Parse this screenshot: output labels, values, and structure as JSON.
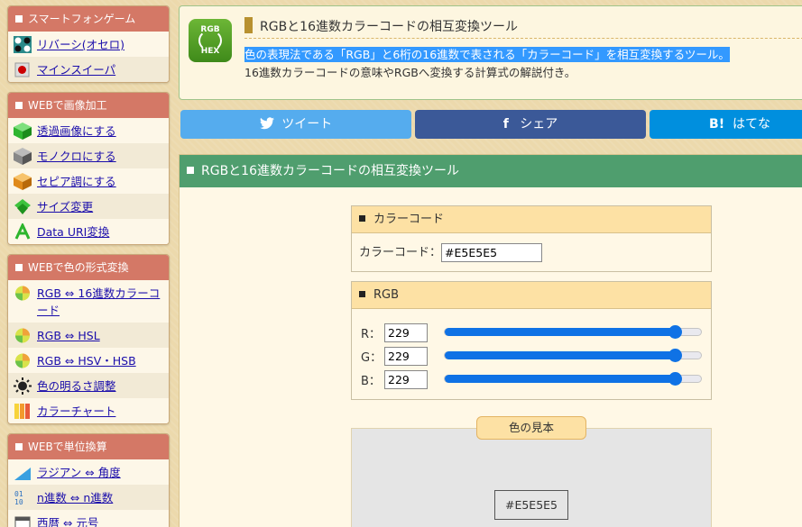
{
  "sidebar": {
    "sections": [
      {
        "title": "スマートフォンゲーム",
        "items": [
          {
            "label": "リバーシ(オセロ)",
            "icon": "reversi-icon"
          },
          {
            "label": "マインスイーパ",
            "icon": "mine-icon"
          }
        ]
      },
      {
        "title": "WEBで画像加工",
        "items": [
          {
            "label": "透過画像にする",
            "icon": "green-cube-icon"
          },
          {
            "label": "モノクロにする",
            "icon": "gray-cube-icon"
          },
          {
            "label": "セピア調にする",
            "icon": "orange-cube-icon"
          },
          {
            "label": "サイズ変更",
            "icon": "resize-icon"
          },
          {
            "label": "Data URI変換",
            "icon": "data-uri-icon"
          }
        ]
      },
      {
        "title": "WEBで色の形式変換",
        "items": [
          {
            "label": "RGB ⇔ 16進数カラーコード",
            "icon": "color-ball-icon"
          },
          {
            "label": "RGB ⇔ HSL",
            "icon": "color-ball-icon"
          },
          {
            "label": "RGB ⇔ HSV・HSB",
            "icon": "color-ball-icon"
          },
          {
            "label": "色の明るさ調整",
            "icon": "brightness-icon"
          },
          {
            "label": "カラーチャート",
            "icon": "color-chart-icon"
          }
        ]
      },
      {
        "title": "WEBで単位換算",
        "items": [
          {
            "label": "ラジアン ⇔ 角度",
            "icon": "angle-icon"
          },
          {
            "label": "n進数 ⇔ n進数",
            "icon": "binary-icon"
          },
          {
            "label": "西暦 ⇔ 元号",
            "icon": "calendar-icon"
          }
        ]
      }
    ]
  },
  "header": {
    "icon_top": "RGB",
    "icon_bottom": "HEX",
    "title": "RGBと16進数カラーコードの相互変換ツール",
    "desc_highlight": "色の表現法である「RGB」と6桁の16進数で表される「カラーコード」を相互変換するツール。",
    "desc_line2": "16進数カラーコードの意味やRGBへ変換する計算式の解説付き。"
  },
  "share": {
    "tweet": "ツイート",
    "facebook": "シェア",
    "facebook_glyph": "f",
    "hatena_glyph": "B!",
    "hatena": "はてな",
    "tweet_color": "#55acee",
    "facebook_color": "#3b5998",
    "hatena_color": "#008fde"
  },
  "tool": {
    "heading": "RGBと16進数カラーコードの相互変換ツール",
    "color_code_panel": {
      "title": "カラーコード",
      "label": "カラーコード：",
      "value": "#E5E5E5"
    },
    "rgb_panel": {
      "title": "RGB",
      "rows": [
        {
          "label": "R：",
          "value": "229",
          "level": 0.898
        },
        {
          "label": "G：",
          "value": "229",
          "level": 0.898
        },
        {
          "label": "B：",
          "value": "229",
          "level": 0.898
        }
      ]
    },
    "sample": {
      "tab": "色の見本",
      "code": "#E5E5E5",
      "color": "#E5E5E5"
    }
  },
  "colors": {
    "sidebar_header": "#d47866",
    "tool_header": "#4f9e6e",
    "slider": "#0f72e5"
  }
}
